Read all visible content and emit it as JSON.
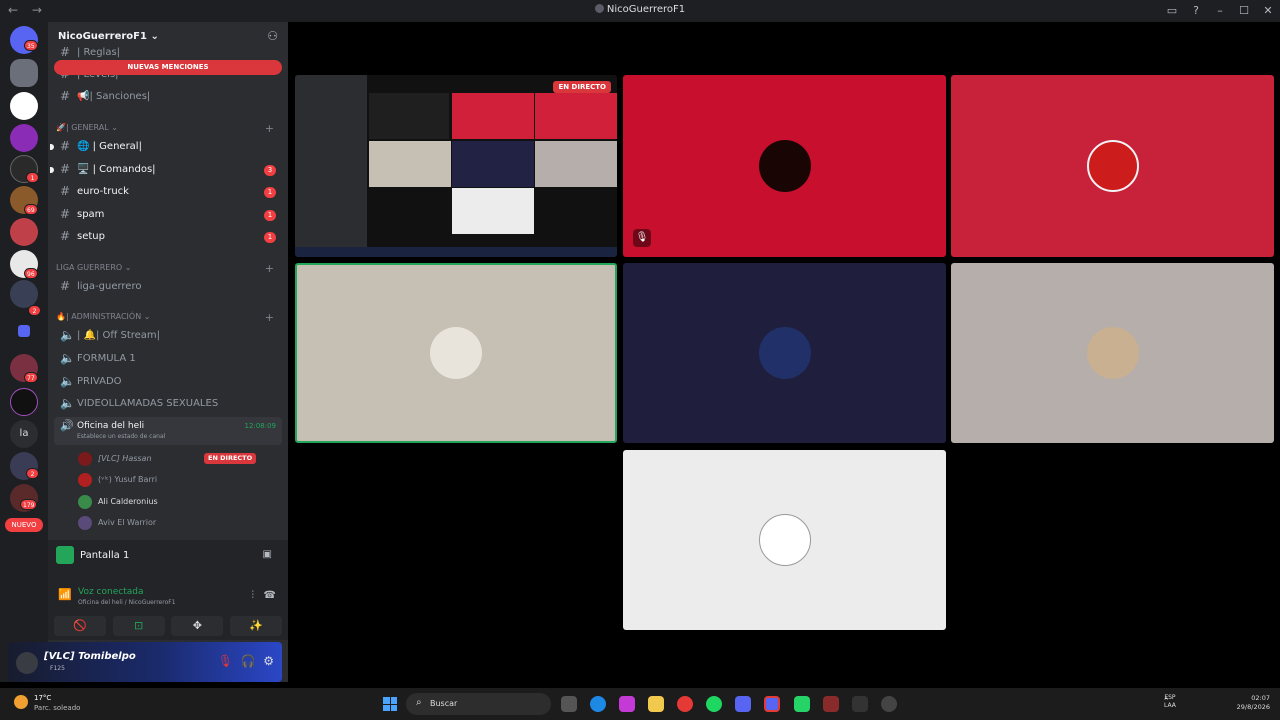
{
  "window": {
    "title": "NicoGuerreroF1",
    "back": "←",
    "forward": "→",
    "inbox_icon": "inbox-icon",
    "help_icon": "help-icon",
    "minimize": "–",
    "maximize": "☐",
    "close": "✕"
  },
  "servers": [
    {
      "badge": "35"
    },
    {
      "badge": ""
    },
    {
      "badge": ""
    },
    {
      "badge": ""
    },
    {
      "badge": "1"
    },
    {
      "badge": "69"
    },
    {
      "badge": ""
    },
    {
      "badge": "96"
    },
    {
      "badge": "2"
    },
    {
      "badge": "77"
    },
    {
      "badge": ""
    },
    {
      "badge": ""
    },
    {
      "badge": "2"
    },
    {
      "badge": "179"
    }
  ],
  "server_label_la": "la",
  "nuevo": "NUEVO",
  "server_name": "NicoGuerreroF1",
  "server_name_chevron": "⌄",
  "new_mentions": "NUEVAS MENCIONES",
  "channels_top": [
    {
      "name": "| Reglas|"
    },
    {
      "name": "| Levels|"
    },
    {
      "name": "📢| Sanciones|"
    }
  ],
  "categories": {
    "general": "🚀| GENERAL",
    "liga": "LIGA GUERRERO",
    "admin": "🔥| ADMINISTRACIÓN"
  },
  "general_channels": [
    {
      "name": "🌐 | General|",
      "count": "",
      "unread": true
    },
    {
      "name": "🖥️ | Comandos|",
      "count": "3",
      "unread": true
    },
    {
      "name": "euro-truck",
      "count": "1",
      "unread": true
    },
    {
      "name": "spam",
      "count": "1",
      "unread": true
    },
    {
      "name": "setup",
      "count": "1",
      "unread": true
    }
  ],
  "liga_channels": [
    {
      "name": "liga-guerrero"
    }
  ],
  "admin_channels": [
    {
      "name": "| 🔔| Off Stream|"
    },
    {
      "name": "FORMULA 1"
    },
    {
      "name": "PRIVADO"
    },
    {
      "name": "VIDEOLLAMADAS SEXUALES"
    }
  ],
  "active_voice": {
    "name": "Oficina del heli",
    "status": "Establece un estado de canal",
    "time": "12:08:09"
  },
  "voice_users": [
    {
      "name": "[VLC] Hassan",
      "live": "EN DIRECTO"
    },
    {
      "name": "(ᵛˡᶜ) Yusuf Barri",
      "live": ""
    },
    {
      "name": "Ali Calderonius",
      "live": ""
    },
    {
      "name": "Aviv El Warrior",
      "live": ""
    }
  ],
  "screen_share": {
    "label": "Pantalla 1"
  },
  "voice_status": {
    "title": "Voz conectada",
    "subtitle": "Oficina del heli / NicoGuerreroF1"
  },
  "voice_buttons": [
    "🚫",
    "⊡",
    "✥",
    "✨"
  ],
  "user": {
    "name": "[VLC] Tomibelpo",
    "status": "F125"
  },
  "stream": {
    "live_label": "EN DIRECTO"
  },
  "participants": [
    {
      "name": "red-avatar-tile",
      "bg": "#c8102e"
    },
    {
      "name": "cars-avatar-tile",
      "bg": "#c8213a"
    },
    {
      "name": "figure-avatar-tile",
      "bg": "#c5bfb4"
    },
    {
      "name": "redbull-avatar-tile",
      "bg": "#1f1f3d"
    },
    {
      "name": "person-avatar-tile",
      "bg": "#b5aeab"
    },
    {
      "name": "meme-avatar-tile",
      "bg": "#ececec"
    }
  ],
  "taskbar": {
    "temp": "17°C",
    "weather": "Parc. soleado",
    "search": "Buscar",
    "lang_line1": "ESP",
    "lang_line2": "LAA",
    "time": "02:07",
    "date": "29/8/2026"
  },
  "colors": {
    "accent": "#23a55a",
    "danger": "#da373c",
    "panel": "#2b2d31"
  }
}
